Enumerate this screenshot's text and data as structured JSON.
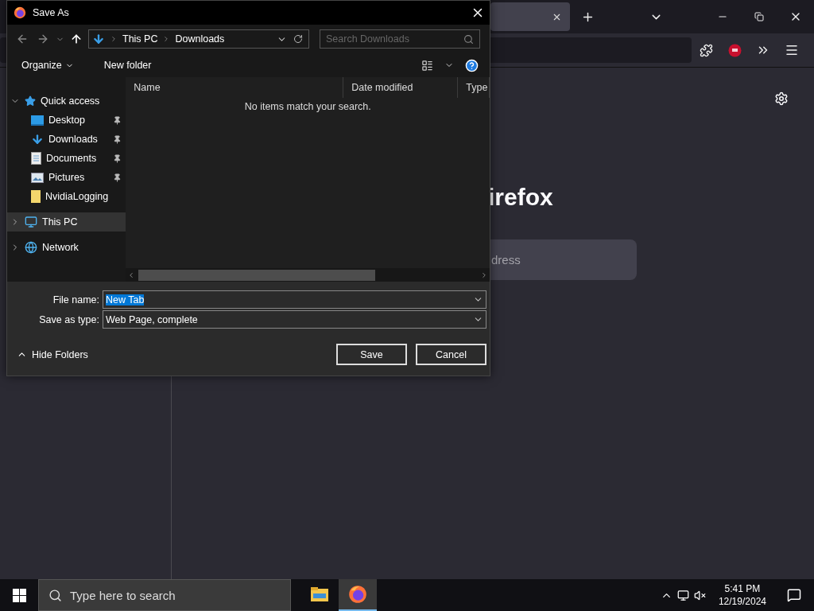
{
  "browser": {
    "heading": "irefox",
    "search": {
      "placeholder": "dress"
    }
  },
  "dialog": {
    "title": "Save As",
    "breadcrumb": [
      "This PC",
      "Downloads"
    ],
    "search": {
      "placeholder": "Search Downloads"
    },
    "commands": [
      "Organize",
      "New folder"
    ],
    "nav_tree": [
      {
        "label": "Quick access",
        "kind": "star",
        "expanded": true,
        "selected": false,
        "children": [
          {
            "label": "Desktop",
            "kind": "desktop",
            "pinned": true,
            "selected": false
          },
          {
            "label": "Downloads",
            "kind": "downloads",
            "pinned": true,
            "selected": false
          },
          {
            "label": "Documents",
            "kind": "documents",
            "pinned": true,
            "selected": false
          },
          {
            "label": "Pictures",
            "kind": "pictures",
            "pinned": true,
            "selected": false
          },
          {
            "label": "NvidiaLogging",
            "kind": "folder",
            "pinned": false,
            "selected": false
          }
        ]
      },
      {
        "label": "This PC",
        "kind": "pc",
        "expanded": false,
        "selected": true
      },
      {
        "label": "Network",
        "kind": "network",
        "expanded": false,
        "selected": false
      }
    ],
    "columns": [
      "Name",
      "Date modified",
      "Type"
    ],
    "empty_message": "No items match your search.",
    "fields": [
      {
        "label": "File name:",
        "value": "New Tab",
        "value_selected": true
      },
      {
        "label": "Save as type:",
        "value": "Web Page, complete",
        "value_selected": false
      }
    ],
    "toggle_folders": "Hide Folders",
    "buttons": [
      "Save",
      "Cancel"
    ]
  },
  "taskbar": {
    "search": {
      "placeholder": "Type here to search"
    },
    "apps": [
      {
        "kind": "explorer",
        "selected": false
      },
      {
        "kind": "firefox",
        "selected": true
      }
    ],
    "time": "5:41 PM",
    "date": "12/19/2024"
  }
}
